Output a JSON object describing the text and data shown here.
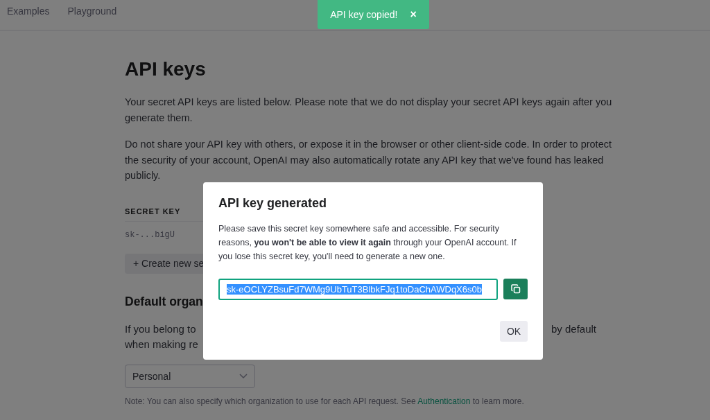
{
  "nav": {
    "items": [
      {
        "label": "Examples"
      },
      {
        "label": "Playground"
      }
    ]
  },
  "page": {
    "title": "API keys",
    "paragraphs": [
      "Your secret API keys are listed below. Please note that we do not display your secret API keys again after you generate them.",
      "Do not share your API key with others, or expose it in the browser or other client-side code. In order to protect the security of your account, OpenAI may also automatically rotate any API key that we've found has leaked publicly."
    ],
    "keys_table": {
      "columns": [
        "SECRET KEY"
      ],
      "rows": [
        [
          "sk-...bigU"
        ]
      ]
    },
    "create_button": {
      "icon": "+",
      "label": "Create new se"
    },
    "org_title": "Default organ",
    "org_text_lines": [
      {
        "left": "If you belong to",
        "right": "by default"
      },
      {
        "left": "when making re"
      }
    ],
    "org_select": {
      "value": "Personal"
    },
    "note": {
      "before": "Note: You can also specify which organization to use for each API request. See ",
      "link": "Authentication",
      "after": " to learn more."
    }
  },
  "toast": {
    "message": "API key copied!",
    "close": "×"
  },
  "dialog": {
    "title": "API key generated",
    "text": "Please save this secret key somewhere safe and accessible. For security reasons, **you won't be able to view it again** through your OpenAI account. If you lose this secret key, you'll need to generate a new one.",
    "key_field": {
      "value": "sk-eOCLYZBsuFd7WMg9UbTuT3BlbkFJq1toDaChAWDqX6s0b",
      "selected": true
    },
    "ok_button": "OK"
  }
}
